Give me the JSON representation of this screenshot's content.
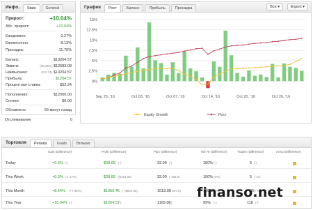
{
  "info_panel": {
    "title": "Инфо.",
    "tabs": [
      "Stats",
      "General"
    ],
    "gain": {
      "label": "Прирост:",
      "value": "+10.04%"
    },
    "abs_gain": {
      "label": "Абс. прирост:",
      "value": "+10.04%"
    },
    "daily": {
      "label": "Ежедневно:",
      "value": "0.27%"
    },
    "monthly": {
      "label": "Ежемесячно:",
      "value": "8.13%"
    },
    "drawdown": {
      "label": "Просадка:",
      "value": "11.70%"
    },
    "balance": {
      "label": "Баланс:",
      "value": "$13204.57"
    },
    "equity": {
      "label": "Эквити:",
      "prefix": "(96.26%)",
      "value": "$12683.08"
    },
    "highest": {
      "label": "Наивысшее:",
      "prefix": "(Oct 31)",
      "value": "$13204.57"
    },
    "profit": {
      "label": "Прибыль:",
      "value": "$1204.57"
    },
    "interest": {
      "label": "Процентная ставка:",
      "value": "$52.24"
    },
    "deposits": {
      "label": "Пополнения:",
      "value": "$12000.00"
    },
    "withdrawals": {
      "label": "Снятия:",
      "value": "$0.00"
    },
    "updated": {
      "label": "Обновлено:",
      "value": "59 минут назад"
    },
    "tracking": {
      "label": "Отслеживание",
      "value": "0"
    }
  },
  "chart_panel": {
    "title": "График",
    "tabs": [
      "Рост",
      "Баланс",
      "Прибыль",
      "Просадка"
    ],
    "dropdown_label": "Все",
    "export_label": "Export"
  },
  "chart_data": {
    "type": "bar",
    "x_ticks": [
      "Sep 25, '16",
      "Oct 03, '16",
      "Oct 07, '16",
      "Oct 14, '16",
      "Oct 20, '16",
      "Oct 26, '16"
    ],
    "y_ticks": [
      "0%",
      "2.5%",
      "5%",
      "7.5%",
      "10%",
      "12.5%",
      "15%"
    ],
    "ylim": [
      -2.5,
      15
    ],
    "daily_bars": [
      0.9,
      1.6,
      2.0,
      1.8,
      6.2,
      3.5,
      8.2,
      3.1,
      14.3,
      5.1,
      4.4,
      1.6,
      4.6,
      2.0,
      7.2,
      3.1,
      2.4,
      0.9,
      -1.7,
      4.8,
      3.5,
      12.3,
      6.3,
      2.0,
      1.1,
      2.6,
      1.3,
      1.6,
      1.0,
      4.2,
      0.9,
      4.3,
      3.5,
      3.2,
      2.5
    ],
    "bar_colors": {
      "positive": "#80cc80",
      "negative": "#e03b3b"
    },
    "series": [
      {
        "name": "Рост",
        "color": "#c2435d",
        "values": [
          0.6,
          0.8,
          1.5,
          2.0,
          3.2,
          3.7,
          4.6,
          5.5,
          6.0,
          6.2,
          6.4,
          6.6,
          6.8,
          7.0,
          7.3,
          7.6,
          7.9,
          8.0,
          6.5,
          7.4,
          7.8,
          8.3,
          8.6,
          8.7,
          8.8,
          9.0,
          9.2,
          9.3,
          9.4,
          9.6,
          9.7,
          9.9,
          10.1,
          10.2,
          10.4
        ]
      },
      {
        "name": "Equity Growth",
        "color": "#f0c23a",
        "values": [
          0.6,
          0.8,
          1.2,
          1.4,
          1.8,
          2.1,
          2.4,
          2.6,
          2.9,
          3.0,
          3.1,
          3.1,
          3.2,
          2.6,
          1.6,
          1.2,
          0.4,
          -0.9,
          -0.7,
          1.0,
          1.7,
          2.4,
          3.0,
          3.0,
          3.1,
          3.2,
          3.3,
          3.4,
          3.5,
          3.6,
          3.7,
          3.8,
          4.1,
          4.8,
          5.5
        ]
      }
    ],
    "legend": [
      "Equity Growth",
      "Рост"
    ]
  },
  "trading_panel": {
    "title": "Торговля",
    "tabs": [
      "Periods",
      "Goals",
      "Browser"
    ],
    "columns": [
      "Gain (Difference)",
      "Profit (Difference)",
      "Pips (Difference)",
      "Win % (Difference)",
      "Trades (Difference)",
      "Лоты (Difference)"
    ],
    "rows": [
      {
        "label": "Today",
        "gain": "+0.3%",
        "gain_diff": "(-)",
        "profit": "$38.89",
        "profit_diff": "(-)",
        "pips": "33.00",
        "pips_diff": "(-)",
        "win": "100%",
        "win_diff": "(-)",
        "trades": "5",
        "trades_diff": "(-)"
      },
      {
        "label": "This Week",
        "gain": "+0.3%",
        "gain_diff": "(-1.17%)",
        "profit": "$38.89",
        "profit_diff": "($151.66)",
        "pips": "33.00",
        "pips_diff": "(-156.0)",
        "win": "100%",
        "win_diff": "(0%)",
        "trades": "5",
        "trades_diff": "(-17)"
      },
      {
        "label": "This Month",
        "gain": "+8.64%",
        "gain_diff": "(+7.36%)",
        "profit": "$1050.46",
        "profit_diff": "(+$894.35)",
        "pips": "1013.00",
        "pips_diff": "(+857.0)",
        "win": "100%",
        "win_diff": "(0%)",
        "trades": "96",
        "trades_diff": "(+78)"
      },
      {
        "label": "This Year",
        "gain": "+10.04%",
        "gain_diff": "(-)",
        "profit": "$1204.57",
        "profit_diff": "(-)",
        "pips": "1169.00",
        "pips_diff": "(-)",
        "win": "99%",
        "win_diff": "(-)",
        "trades": "118",
        "trades_diff": "(-)"
      }
    ]
  },
  "watermark": {
    "text": "finanso.net"
  }
}
